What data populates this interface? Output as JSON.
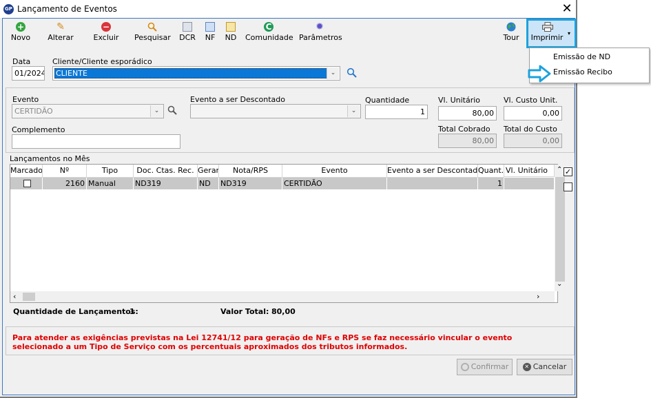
{
  "window": {
    "title": "Lançamento de Eventos",
    "logo_text": "GP",
    "close_glyph": "✕"
  },
  "toolbar": {
    "items": [
      {
        "label": "Novo",
        "icon": "plus-circle-icon",
        "glyph": "+"
      },
      {
        "label": "Alterar",
        "icon": "pencil-icon",
        "glyph": "✎"
      },
      {
        "label": "Excluir",
        "icon": "minus-circle-icon",
        "glyph": "−"
      },
      {
        "label": "Pesquisar",
        "icon": "magnifier-icon",
        "glyph": "🔍"
      },
      {
        "label": "DCR",
        "icon": "document-icon",
        "glyph": ""
      },
      {
        "label": "NF",
        "icon": "document-icon",
        "glyph": ""
      },
      {
        "label": "ND",
        "icon": "document-icon",
        "glyph": ""
      },
      {
        "label": "Comunidade",
        "icon": "community-icon",
        "glyph": "C"
      },
      {
        "label": "Parâmetros",
        "icon": "gear-icon",
        "glyph": "✹"
      },
      {
        "label": "Tour",
        "icon": "globe-icon",
        "glyph": ""
      },
      {
        "label": "Imprimir",
        "icon": "printer-icon",
        "glyph": "⎙"
      }
    ],
    "dropdown_glyph": "▾"
  },
  "print_menu": {
    "items": [
      "Emissão de ND",
      "Emissão Recibo"
    ]
  },
  "header_form": {
    "data_label": "Data",
    "data_value": "01/2024",
    "cliente_label": "Cliente/Cliente esporádico",
    "cliente_value": "CLIENTE"
  },
  "event_form": {
    "evento_label": "Evento",
    "evento_value": "CERTIDÃO",
    "evento_desc_label": "Evento a ser Descontado",
    "evento_desc_value": "",
    "quantidade_label": "Quantidade",
    "quantidade_value": "1",
    "vl_unitario_label": "Vl. Unitário",
    "vl_unitario_value": "80,00",
    "vl_custo_label": "Vl. Custo Unit.",
    "vl_custo_value": "0,00",
    "complemento_label": "Complemento",
    "complemento_value": "",
    "total_cobrado_label": "Total Cobrado",
    "total_cobrado_value": "80,00",
    "total_custo_label": "Total do Custo",
    "total_custo_value": "0,00"
  },
  "grid": {
    "section_label": "Lançamentos no Mês",
    "columns": [
      "Marcado",
      "Nº",
      "Tipo",
      "Doc. Ctas. Rec.",
      "Gerar",
      "Nota/RPS",
      "Evento",
      "Evento a ser Descontado",
      "Quant.",
      "Vl. Unitário"
    ],
    "rows": [
      {
        "marcado": false,
        "numero": "2160",
        "tipo": "Manual",
        "doc": "ND319",
        "gerar": "ND",
        "nota": "ND319",
        "evento": "CERTIDÃO",
        "evento_desc": "",
        "quant": "1",
        "vl_unitario": ""
      }
    ]
  },
  "side_checks": {
    "check_all": true,
    "uncheck_all": false
  },
  "summary": {
    "qtd_label": "Quantidade de Lançamentos:",
    "qtd_value": "1",
    "total_label": "Valor Total:",
    "total_value": "80,00"
  },
  "warning": {
    "line1": "Para atender as exigências previstas na Lei 12741/12 para geração de NFs e RPS se faz necessário vincular o evento",
    "line2": "selecionado a um Tipo de Serviço com os percentuais aproximados dos tributos informados."
  },
  "buttons": {
    "confirmar": "Confirmar",
    "cancelar": "Cancelar"
  },
  "colors": {
    "accent": "#1da1dd",
    "selection": "#0b78d7",
    "warning": "#e00000"
  }
}
